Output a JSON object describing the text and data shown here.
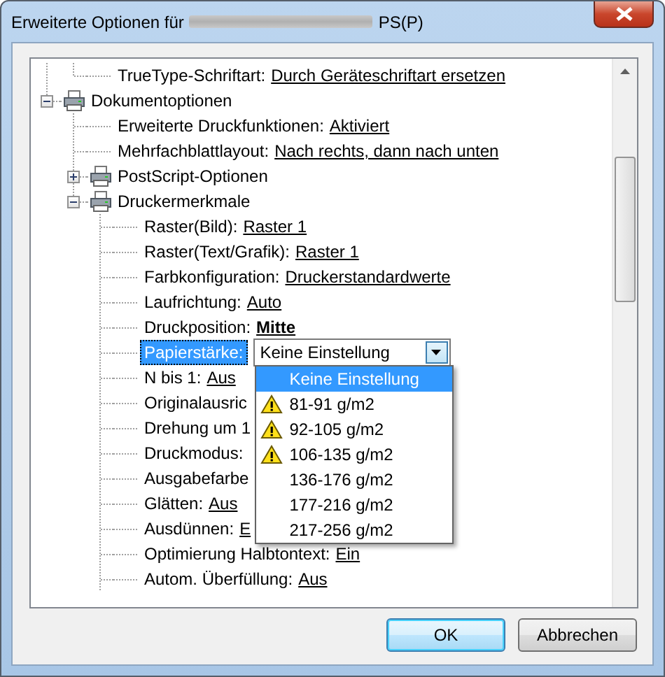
{
  "window": {
    "title": "Erweiterte Optionen für",
    "title_suffix": "PS(P)"
  },
  "tree": [
    {
      "kind": "offscreen-parent",
      "children": [
        {
          "kind": "setting",
          "label": "TrueType-Schriftart:",
          "value": "Durch Geräteschriftart ersetzen",
          "selected": false
        }
      ]
    },
    {
      "kind": "group",
      "label": "Dokumentoptionen",
      "expanded": true,
      "selected": false,
      "children": [
        {
          "kind": "setting",
          "label": "Erweiterte Druckfunktionen:",
          "value": "Aktiviert",
          "selected": false
        },
        {
          "kind": "setting",
          "label": "Mehrfachblattlayout:",
          "value": "Nach rechts, dann nach unten",
          "selected": false
        },
        {
          "kind": "group",
          "label": "PostScript-Optionen",
          "expanded": false,
          "selected": false
        },
        {
          "kind": "group",
          "label": "Druckermerkmale",
          "expanded": true,
          "selected": false,
          "children": [
            {
              "kind": "setting",
              "label": "Raster(Bild):",
              "value": "Raster 1",
              "selected": false
            },
            {
              "kind": "setting",
              "label": "Raster(Text/Grafik):",
              "value": "Raster 1",
              "selected": false
            },
            {
              "kind": "setting",
              "label": "Farbkonfiguration:",
              "value": "Druckerstandardwerte",
              "selected": false
            },
            {
              "kind": "setting",
              "label": "Laufrichtung:",
              "value": "Auto",
              "selected": false
            },
            {
              "kind": "setting",
              "label": "Druckposition:",
              "value": "Mitte",
              "bold": true,
              "selected": false
            },
            {
              "kind": "combo",
              "label": "Papierstärke:",
              "value": "Keine Einstellung",
              "selected": true,
              "open": true,
              "options": [
                {
                  "label": "Keine Einstellung",
                  "selected": true,
                  "warning": false
                },
                {
                  "label": "81-91 g/m2",
                  "selected": false,
                  "warning": true
                },
                {
                  "label": "92-105 g/m2",
                  "selected": false,
                  "warning": true
                },
                {
                  "label": "106-135 g/m2",
                  "selected": false,
                  "warning": true
                },
                {
                  "label": "136-176 g/m2",
                  "selected": false,
                  "warning": false
                },
                {
                  "label": "177-216 g/m2",
                  "selected": false,
                  "warning": false
                },
                {
                  "label": "217-256 g/m2",
                  "selected": false,
                  "warning": false
                }
              ]
            },
            {
              "kind": "setting",
              "label": "N bis 1:",
              "value": "Aus",
              "selected": false
            },
            {
              "kind": "setting",
              "label": "Originalausric",
              "selected": false
            },
            {
              "kind": "setting",
              "label": "Drehung um 1",
              "selected": false
            },
            {
              "kind": "setting",
              "label": "Druckmodus:",
              "selected": false
            },
            {
              "kind": "setting",
              "label": "Ausgabefarbe",
              "selected": false
            },
            {
              "kind": "setting",
              "label": "Glätten:",
              "value": "Aus",
              "selected": false
            },
            {
              "kind": "setting",
              "label": "Ausdünnen:",
              "value": "E",
              "selected": false
            },
            {
              "kind": "setting",
              "label": "Optimierung Halbtontext:",
              "value": "Ein",
              "selected": false
            },
            {
              "kind": "setting",
              "label": "Autom. Überfüllung:",
              "value": "Aus",
              "selected": false
            }
          ]
        }
      ]
    }
  ],
  "buttons": [
    {
      "label": "OK",
      "default": true
    },
    {
      "label": "Abbrechen",
      "default": false
    }
  ]
}
